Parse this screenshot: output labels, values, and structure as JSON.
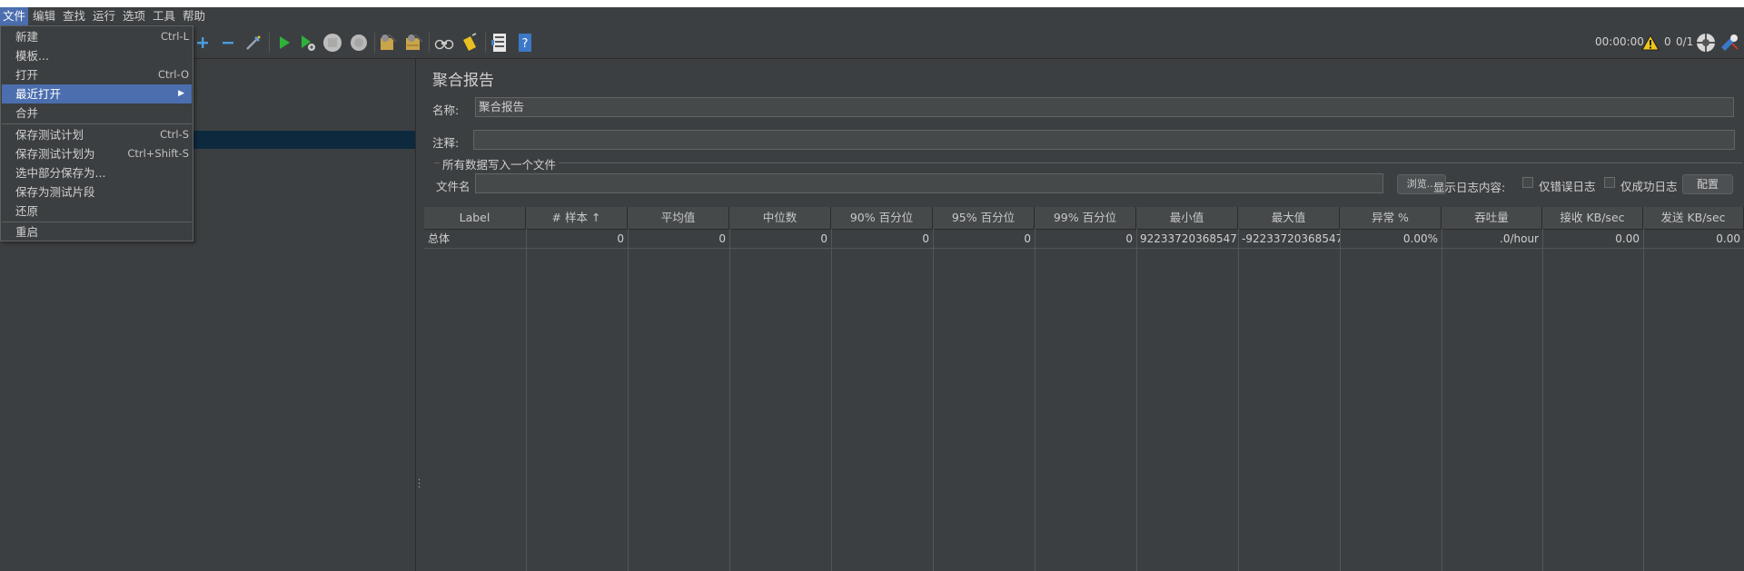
{
  "menubar": {
    "items": [
      "文件",
      "编辑",
      "查找",
      "运行",
      "选项",
      "工具",
      "帮助"
    ]
  },
  "file_menu": {
    "items": [
      {
        "label": "新建",
        "shortcut": "Ctrl-L"
      },
      {
        "label": "模板...",
        "shortcut": ""
      },
      {
        "label": "打开",
        "shortcut": "Ctrl-O"
      },
      {
        "label": "最近打开",
        "shortcut": ""
      },
      {
        "label": "合并",
        "shortcut": ""
      },
      {
        "label": "保存测试计划",
        "shortcut": "Ctrl-S"
      },
      {
        "label": "保存测试计划为",
        "shortcut": "Ctrl+Shift-S"
      },
      {
        "label": "选中部分保存为...",
        "shortcut": ""
      },
      {
        "label": "保存为测试片段",
        "shortcut": ""
      },
      {
        "label": "还原",
        "shortcut": ""
      },
      {
        "label": "重启",
        "shortcut": ""
      }
    ]
  },
  "toolbar": {
    "icons": [
      "add-icon",
      "remove-icon",
      "toggle-icon",
      "start-icon",
      "start-no-pause-icon",
      "stop-icon",
      "shutdown-icon",
      "clear-icon",
      "clear-all-icon",
      "search-icon",
      "reset-search-icon",
      "function-helper-icon",
      "help-icon"
    ],
    "elapsed": "00:00:00",
    "warnings": "0",
    "threads": "0/1"
  },
  "panel": {
    "title": "聚合报告",
    "name_label": "名称:",
    "name_value": "聚合报告",
    "comment_label": "注释:",
    "comment_value": "",
    "file_group_title": "所有数据写入一个文件",
    "filename_label": "文件名",
    "filename_value": "",
    "browse_label": "浏览...",
    "log_content_label": "显示日志内容:",
    "errors_only_label": "仅错误日志",
    "success_only_label": "仅成功日志",
    "configure_label": "配置"
  },
  "table": {
    "headers": [
      "Label",
      "# 样本 ↑",
      "平均值",
      "中位数",
      "90% 百分位",
      "95% 百分位",
      "99% 百分位",
      "最小值",
      "最大值",
      "异常 %",
      "吞吐量",
      "接收 KB/sec",
      "发送 KB/sec"
    ],
    "rows": [
      [
        "总体",
        "0",
        "0",
        "0",
        "0",
        "0",
        "0",
        "922337203685477...",
        "-92233720368547...",
        "0.00%",
        ".0/hour",
        "0.00",
        "0.00"
      ]
    ]
  },
  "colors": {
    "background": "#3c3f41",
    "menu_highlight": "#4b6eaf",
    "tree_selection": "#0d293e"
  }
}
